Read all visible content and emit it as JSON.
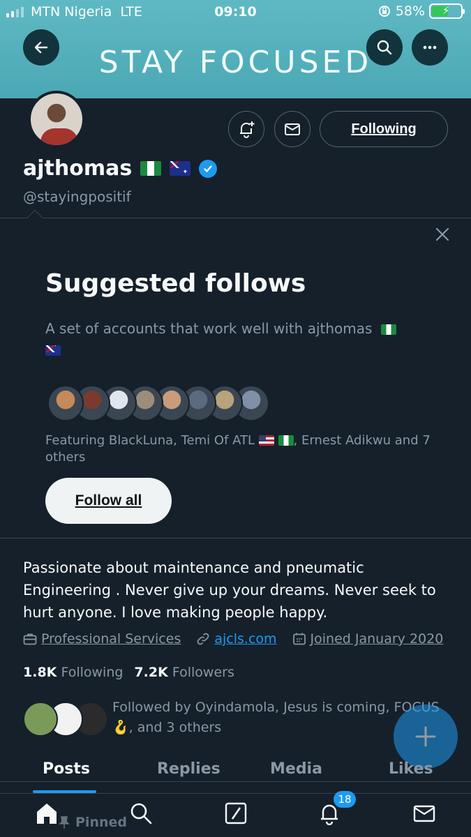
{
  "status_bar": {
    "carrier": "MTN Nigeria",
    "network": "LTE",
    "time": "09:10",
    "battery": "58%",
    "battery_level": 0.58
  },
  "header": {
    "banner_text": "STAY FOCUSED",
    "back_icon": "arrow-left-icon",
    "search_icon": "search-icon",
    "more_icon": "more-horizontal-icon"
  },
  "profile": {
    "display_name": "ajthomas",
    "handle": "@stayingpositif",
    "following_button": "Following",
    "bio": "Passionate about maintenance and pneumatic Engineering . Never give up your dreams. Never seek to hurt anyone. I love making people happy.",
    "category": "Professional Services",
    "website": "ajcls.com",
    "joined": "Joined January 2020",
    "following_count": "1.8K",
    "following_label": "Following",
    "followers_count": "7.2K",
    "followers_label": "Followers",
    "followed_by": "Followed by Oyindamola, Jesus is coming, FOCUS 🪝, and 3 others"
  },
  "suggested": {
    "title": "Suggested follows",
    "subtitle": "A set of accounts that work well with ajthomas",
    "featuring_prefix": "Featuring BlackLuna, Temi Of ATL",
    "featuring_suffix": ", Ernest Adikwu and 7 others",
    "follow_all": "Follow all",
    "avatar_colors": [
      "#c48a5a",
      "#7a3b2e",
      "#dfe6ee",
      "#9c8c7a",
      "#c99c7d",
      "#5a6b80",
      "#b8a37a",
      "#8090a8"
    ]
  },
  "followed_avatar_colors": [
    "#7a9a5a",
    "#f2f2f2",
    "#2b2b2b"
  ],
  "tabs": [
    "Posts",
    "Replies",
    "Media",
    "Likes"
  ],
  "pinned_label": "Pinned",
  "notifications_badge": "18",
  "colors": {
    "accent": "#1d9bf0",
    "background": "#15202b",
    "banner": "#5fb9c4",
    "muted_text": "#8b98a5"
  }
}
